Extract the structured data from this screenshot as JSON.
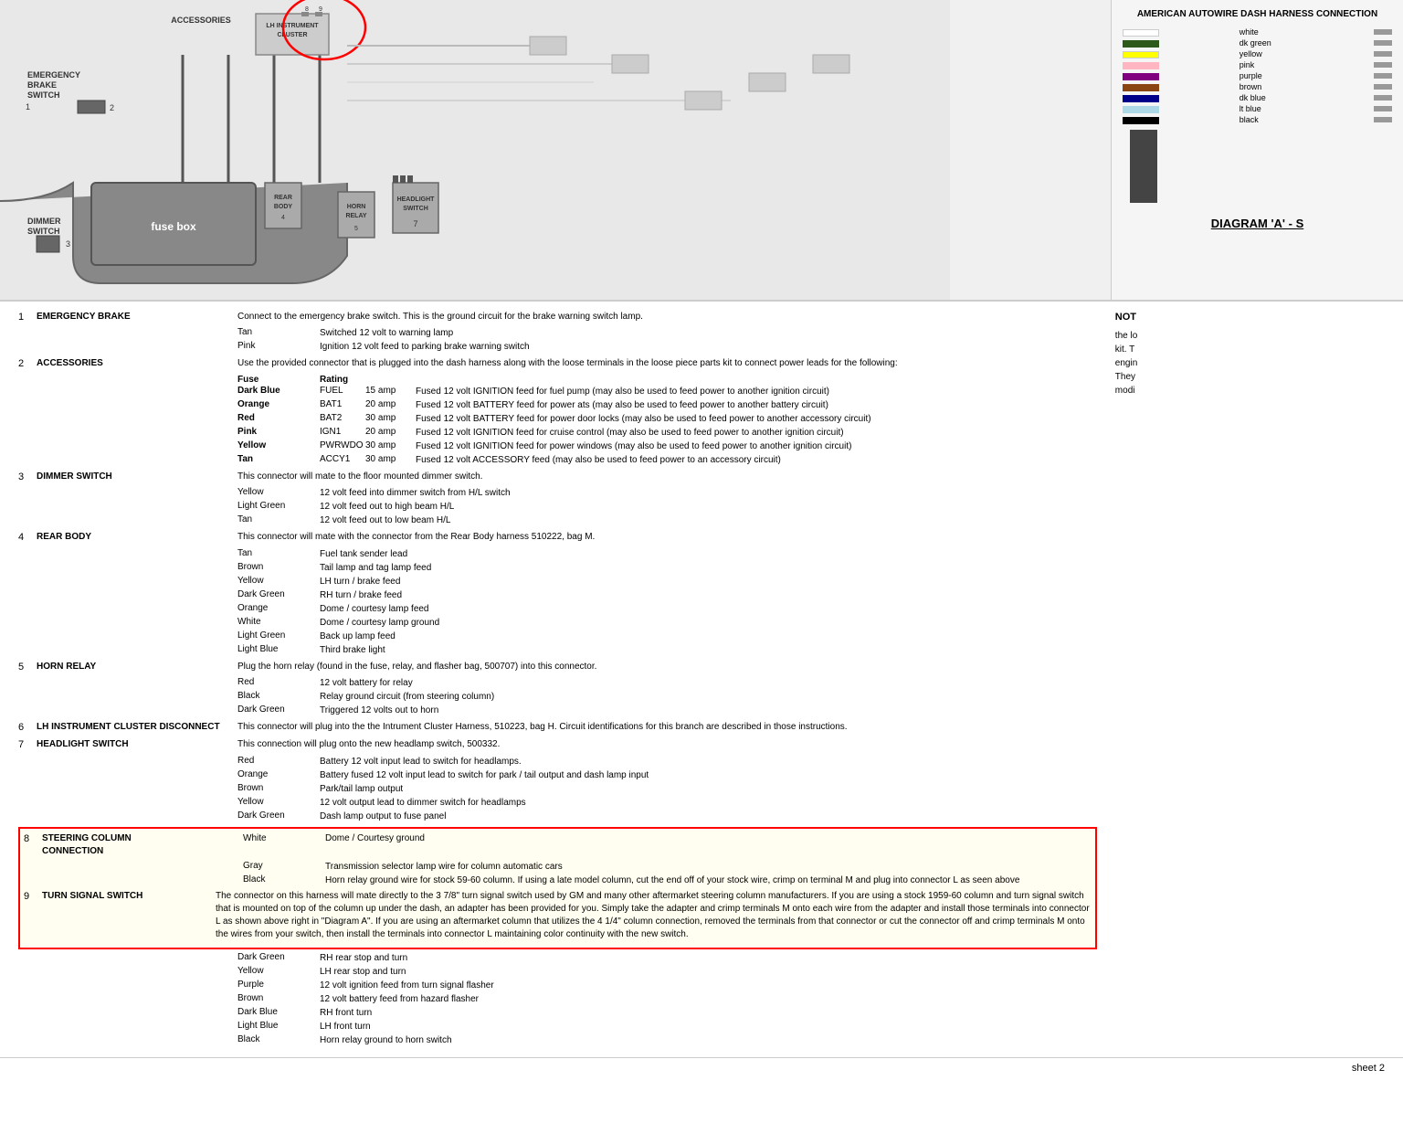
{
  "diagram": {
    "title": "AMERICAN AUTOWIRE DASH HARNESS CONNECTION",
    "diagram_label": "DIAGRAM 'A' - S",
    "components": [
      {
        "id": "emergency_brake",
        "label": "EMERGENCY\nBRAKE\nSWITCH",
        "num": "1"
      },
      {
        "id": "accessories",
        "label": "ACCESSORIES"
      },
      {
        "id": "lh_instrument",
        "label": "LH INSTRUMENT\nCLUSTER"
      },
      {
        "id": "dimmer_switch",
        "label": "DIMMER\nSWITCH",
        "num": "3"
      },
      {
        "id": "fuse_box",
        "label": "fuse box"
      },
      {
        "id": "rear_body",
        "label": "REAR\nBODY",
        "num": "4"
      },
      {
        "id": "horn_relay",
        "label": "HORN\nRELAY",
        "num": "5"
      },
      {
        "id": "headlight_switch",
        "label": "HEADLIGHT\nSWITCH",
        "num": "7"
      }
    ],
    "color_rows": [
      {
        "color": "#ffffff",
        "name": "white"
      },
      {
        "color": "#2d5a1b",
        "name": "dk green"
      },
      {
        "color": "#ffff00",
        "name": "yellow"
      },
      {
        "color": "#ff69b4",
        "name": "pink"
      },
      {
        "color": "#800080",
        "name": "purple"
      },
      {
        "color": "#8b4513",
        "name": "brown"
      },
      {
        "color": "#00008b",
        "name": "dk blue"
      },
      {
        "color": "#add8e6",
        "name": "lt blue"
      },
      {
        "color": "#000000",
        "name": "black"
      }
    ]
  },
  "entries": [
    {
      "num": "1",
      "name": "EMERGENCY BRAKE",
      "desc": "Connect to the emergency brake switch. This is the ground circuit for the brake warning switch lamp.",
      "sub": [
        {
          "color": "Tan",
          "desc": "Switched 12 volt to warning lamp"
        },
        {
          "color": "Pink",
          "desc": "Ignition 12 volt feed to parking brake warning switch"
        }
      ]
    },
    {
      "num": "2",
      "name": "ACCESSORIES",
      "desc": "Use the provided connector that is plugged into the dash harness along with the loose terminals in the loose piece parts kit to connect power leads for the following:",
      "fuse_header": true,
      "fuses": [
        {
          "color": "Dark Blue",
          "name": "FUEL",
          "amp": "15 amp",
          "desc": "Fused 12 volt IGNITION feed for fuel pump (may also be used to feed power to another ignition circuit)"
        },
        {
          "color": "Orange",
          "name": "BAT1",
          "amp": "20 amp",
          "desc": "Fused 12 volt BATTERY feed for power ats (may also be used to feed power to another battery circuit)"
        },
        {
          "color": "Red",
          "name": "BAT2",
          "amp": "30 amp",
          "desc": "Fused 12 volt BATTERY feed for power door locks (may also be used to feed power to another accessory circuit)"
        },
        {
          "color": "Pink",
          "name": "IGN1",
          "amp": "20 amp",
          "desc": "Fused 12 volt IGNITION feed for cruise control (may also be used to feed power to another ignition circuit)"
        },
        {
          "color": "Yellow",
          "name": "PWRWDO",
          "amp": "30 amp",
          "desc": "Fused 12 volt IGNITION feed for power windows (may also be used to feed power to another ignition circuit)"
        },
        {
          "color": "Tan",
          "name": "ACCY1",
          "amp": "30 amp",
          "desc": "Fused 12 volt ACCESSORY feed (may also be used to feed power to an accessory circuit)"
        }
      ]
    },
    {
      "num": "3",
      "name": "DIMMER SWITCH",
      "desc": "This connector will mate to the floor mounted dimmer switch.",
      "sub": [
        {
          "color": "Yellow",
          "desc": "12 volt feed into dimmer switch from H/L switch"
        },
        {
          "color": "Light Green",
          "desc": "12 volt feed out to high beam H/L"
        },
        {
          "color": "Tan",
          "desc": "12 volt feed out to low beam H/L"
        }
      ]
    },
    {
      "num": "4",
      "name": "REAR BODY",
      "desc": "This connector will mate with the connector from the Rear Body harness 510222, bag M.",
      "sub": [
        {
          "color": "Tan",
          "desc": "Fuel tank sender lead"
        },
        {
          "color": "Brown",
          "desc": "Tail lamp and tag lamp feed"
        },
        {
          "color": "Yellow",
          "desc": "LH turn / brake feed"
        },
        {
          "color": "Dark Green",
          "desc": "RH turn / brake feed"
        },
        {
          "color": "Orange",
          "desc": "Dome / courtesy lamp feed"
        },
        {
          "color": "White",
          "desc": "Dome / courtesy lamp ground"
        },
        {
          "color": "Light Green",
          "desc": "Back up lamp feed"
        },
        {
          "color": "Light Blue",
          "desc": "Third brake light"
        }
      ]
    },
    {
      "num": "5",
      "name": "HORN RELAY",
      "desc": "Plug the horn relay (found in the fuse, relay, and flasher bag, 500707) into this connector.",
      "sub": [
        {
          "color": "Red",
          "desc": "12 volt battery for relay"
        },
        {
          "color": "Black",
          "desc": "Relay ground circuit (from steering column)"
        },
        {
          "color": "Dark Green",
          "desc": "Triggered 12 volts out to horn"
        }
      ]
    },
    {
      "num": "6",
      "name": "LH INSTRUMENT CLUSTER DISCONNECT",
      "desc": "This connector will plug into the the Intrument Cluster Harness, 510223, bag H. Circuit identifications for this branch are described in those instructions."
    },
    {
      "num": "7",
      "name": "HEADLIGHT SWITCH",
      "desc": "This connection will plug onto the new headlamp switch, 500332.",
      "sub": [
        {
          "color": "Red",
          "desc": "Battery 12 volt input lead to switch for headlamps."
        },
        {
          "color": "Orange",
          "desc": "Battery fused 12 volt input lead to switch for park / tail output and dash lamp input"
        },
        {
          "color": "Brown",
          "desc": "Park/tail lamp output"
        },
        {
          "color": "Yellow",
          "desc": "12 volt output lead to dimmer switch for headlamps"
        },
        {
          "color": "Dark Green",
          "desc": "Dash lamp output to fuse panel"
        }
      ]
    },
    {
      "num": "8",
      "name": "STEERING COLUMN CONNECTION",
      "highlighted": true,
      "desc_pre": "White / Courtesy ground",
      "sub_highlighted": [
        {
          "color": "Gray",
          "desc": "Transmission selector lamp wire for column automatic cars"
        },
        {
          "color": "Black",
          "desc": "Horn relay ground wire for stock 59-60 column. If using a late model column, cut the end off of your stock wire, crimp on terminal M and plug into connector L as seen above"
        }
      ],
      "main_para": "The connector on this harness will mate directly to the 3 7/8\" turn signal switch used by GM and many other aftermarket steering column manufacturers. If you are using a stock 1959-60 column and turn signal switch that is mounted on top of the column up under the dash, an adapter has been provided for you. Simply take the adapter and crimp terminals M onto each wire from the adapter and install those terminals into connector L as shown above right in \"Diagram A\". If you are using an aftermarket column that utilizes the 4 1/4\" column connection, removed the terminals from that connector or cut the connector off and crimp terminals M onto the wires from your switch, then install the terminals into connector L maintaining color continuity with the new switch."
    },
    {
      "num": "9",
      "name": "TURN SIGNAL SWITCH",
      "sub": [
        {
          "color": "Dark Green",
          "desc": "RH rear stop and turn"
        },
        {
          "color": "Yellow",
          "desc": "LH rear stop and turn"
        },
        {
          "color": "Purple",
          "desc": "12 volt ignition feed from turn signal flasher"
        },
        {
          "color": "Brown",
          "desc": "12 volt battery feed from hazard flasher"
        },
        {
          "color": "Dark Blue",
          "desc": "RH front turn"
        },
        {
          "color": "Light Blue",
          "desc": "LH front turn"
        },
        {
          "color": "Black",
          "desc": "Horn relay ground to horn switch"
        }
      ]
    }
  ],
  "side_note": {
    "title": "NOT",
    "text": "the lo kit. T engin They modi"
  },
  "footer": {
    "sheet": "sheet 2"
  }
}
